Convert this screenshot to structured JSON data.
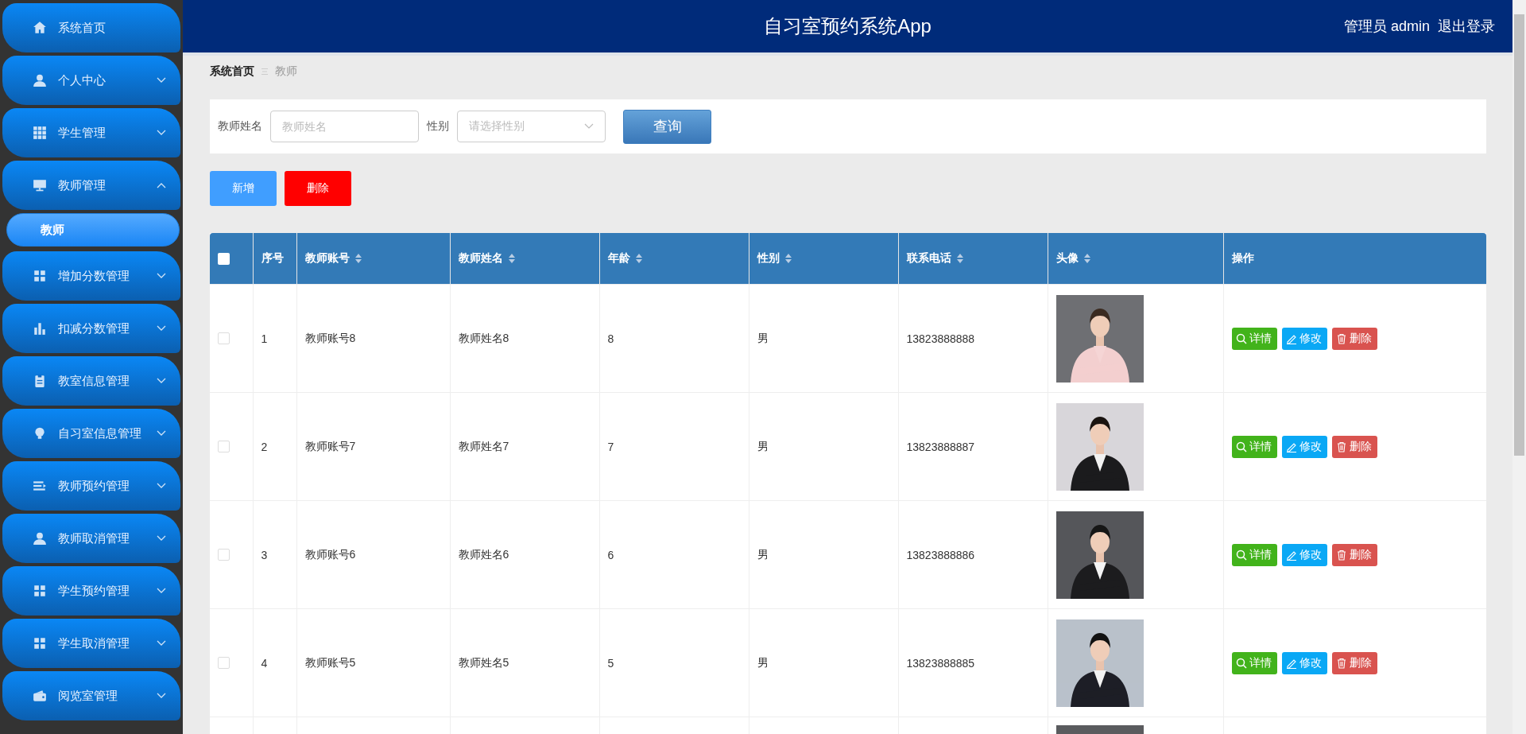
{
  "sidebar": {
    "items": [
      {
        "label": "系统首页",
        "kind": "link"
      },
      {
        "label": "个人中心",
        "kind": "group",
        "expanded": false
      },
      {
        "label": "学生管理",
        "kind": "group",
        "expanded": false
      },
      {
        "label": "教师管理",
        "kind": "group",
        "expanded": true,
        "children": [
          {
            "label": "教师",
            "selected": true
          }
        ]
      },
      {
        "label": "增加分数管理",
        "kind": "group",
        "expanded": false
      },
      {
        "label": "扣减分数管理",
        "kind": "group",
        "expanded": false
      },
      {
        "label": "教室信息管理",
        "kind": "group",
        "expanded": false
      },
      {
        "label": "自习室信息管理",
        "kind": "group",
        "expanded": false
      },
      {
        "label": "教师预约管理",
        "kind": "group",
        "expanded": false
      },
      {
        "label": "教师取消管理",
        "kind": "group",
        "expanded": false
      },
      {
        "label": "学生预约管理",
        "kind": "group",
        "expanded": false
      },
      {
        "label": "学生取消管理",
        "kind": "group",
        "expanded": false
      },
      {
        "label": "阅览室管理",
        "kind": "group",
        "expanded": false
      }
    ]
  },
  "header": {
    "title": "自习室预约系统App",
    "user": "管理员 admin",
    "logout": "退出登录"
  },
  "breadcrumb": [
    "系统首页",
    "教师"
  ],
  "search": {
    "fields": [
      {
        "label": "教师姓名",
        "placeholder": "教师姓名",
        "kind": "text"
      },
      {
        "label": "性别",
        "placeholder": "请选择性别",
        "kind": "select"
      }
    ],
    "button": "查询"
  },
  "actions": [
    {
      "label": "新增",
      "kind": "add"
    },
    {
      "label": "删除",
      "kind": "delete"
    }
  ],
  "table": {
    "select_all": {
      "checked": false
    },
    "columns": [
      {
        "label": "序号",
        "sortable": false
      },
      {
        "label": "教师账号",
        "sortable": true
      },
      {
        "label": "教师姓名",
        "sortable": true
      },
      {
        "label": "年龄",
        "sortable": true
      },
      {
        "label": "性别",
        "sortable": true
      },
      {
        "label": "联系电话",
        "sortable": true
      },
      {
        "label": "头像",
        "sortable": true
      },
      {
        "label": "操作",
        "sortable": false
      }
    ],
    "rows": [
      {
        "checked": false,
        "cells": [
          "1",
          "教师账号8",
          "教师姓名8",
          "8",
          "男",
          "13823888888"
        ],
        "photo": {
          "kind": "picture"
        },
        "actions": [
          {
            "label": "详情",
            "kind": "detail"
          },
          {
            "label": "修改",
            "kind": "edit"
          },
          {
            "label": "删除",
            "kind": "delete"
          }
        ]
      },
      {
        "checked": false,
        "cells": [
          "2",
          "教师账号7",
          "教师姓名7",
          "7",
          "男",
          "13823888887"
        ],
        "photo": {
          "kind": "picture"
        },
        "actions": [
          {
            "label": "详情",
            "kind": "detail"
          },
          {
            "label": "修改",
            "kind": "edit"
          },
          {
            "label": "删除",
            "kind": "delete"
          }
        ]
      },
      {
        "checked": false,
        "cells": [
          "3",
          "教师账号6",
          "教师姓名6",
          "6",
          "男",
          "13823888886"
        ],
        "photo": {
          "kind": "picture"
        },
        "actions": [
          {
            "label": "详情",
            "kind": "detail"
          },
          {
            "label": "修改",
            "kind": "edit"
          },
          {
            "label": "删除",
            "kind": "delete"
          }
        ]
      },
      {
        "checked": false,
        "cells": [
          "4",
          "教师账号5",
          "教师姓名5",
          "5",
          "男",
          "13823888885"
        ],
        "photo": {
          "kind": "picture"
        },
        "actions": [
          {
            "label": "详情",
            "kind": "detail"
          },
          {
            "label": "修改",
            "kind": "edit"
          },
          {
            "label": "删除",
            "kind": "delete"
          }
        ]
      },
      {
        "photo": {
          "kind": "picture"
        }
      }
    ]
  }
}
